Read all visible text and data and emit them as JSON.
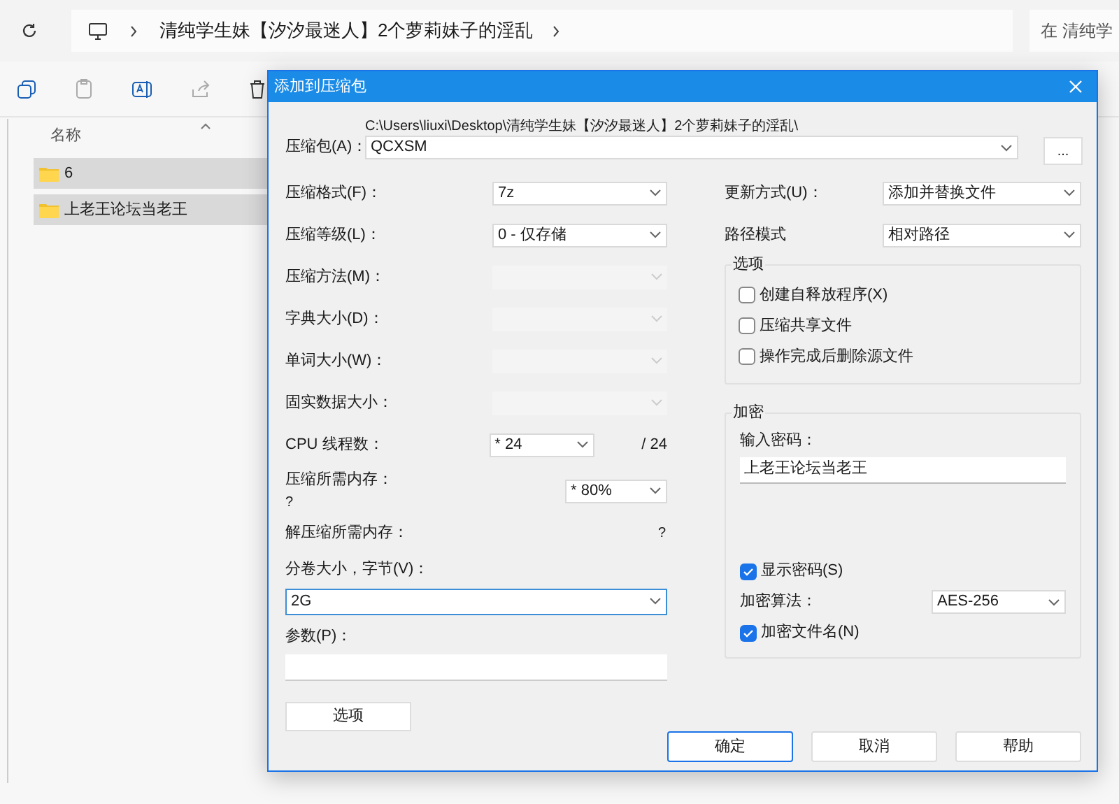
{
  "explorer": {
    "breadcrumb": "清纯学生妹【汐汐最迷人】2个萝莉妹子的淫乱",
    "search_placeholder": "在 清纯学",
    "column": "名称",
    "files": [
      {
        "name": "6",
        "selected": true
      },
      {
        "name": "上老王论坛当老王",
        "selected": true
      }
    ]
  },
  "dialog": {
    "title": "添加到压缩包",
    "archive": {
      "label": "压缩包(A)：",
      "path": "C:\\Users\\liuxi\\Desktop\\清纯学生妹【汐汐最迷人】2个萝莉妹子的淫乱\\",
      "value": "QCXSM",
      "browse": "..."
    },
    "left": [
      {
        "kind": "select",
        "label": "压缩格式(F)：",
        "value": "7z",
        "disabled": false
      },
      {
        "kind": "select",
        "label": "压缩等级(L)：",
        "value": "0 - 仅存储",
        "disabled": false
      },
      {
        "kind": "select",
        "label": "压缩方法(M)：",
        "disabled": true
      },
      {
        "kind": "select",
        "label": "字典大小(D)：",
        "disabled": true
      },
      {
        "kind": "select",
        "label": "单词大小(W)：",
        "disabled": true
      },
      {
        "kind": "select",
        "label": "固实数据大小：",
        "disabled": true
      },
      {
        "kind": "cpu",
        "label": "CPU 线程数：",
        "value": "* 24",
        "suffix": "/ 24"
      },
      {
        "kind": "memory",
        "label": "压缩所需内存：",
        "note": "?",
        "value": "* 80%"
      },
      {
        "kind": "info",
        "label": "解压缩所需内存：",
        "value": "?"
      },
      {
        "kind": "combo",
        "label": "分卷大小，字节(V)：",
        "value": "2G",
        "focused": true
      },
      {
        "kind": "input",
        "label": "参数(P)："
      }
    ],
    "options_button": "选项",
    "right": [
      {
        "label": "更新方式(U)：",
        "value": "添加并替换文件"
      },
      {
        "label": "路径模式",
        "value": "相对路径"
      }
    ],
    "options_group": {
      "title": "选项",
      "checks": [
        {
          "label": "创建自释放程序(X)",
          "checked": false
        },
        {
          "label": "压缩共享文件",
          "checked": false
        },
        {
          "label": "操作完成后删除源文件",
          "checked": false
        }
      ]
    },
    "encryption": {
      "title": "加密",
      "password_label": "输入密码：",
      "password": "上老王论坛当老王",
      "show_password": {
        "label": "显示密码(S)",
        "checked": true
      },
      "method_label": "加密算法：",
      "method": "AES-256",
      "encrypt_names": {
        "label": "加密文件名(N)",
        "checked": true
      }
    },
    "buttons": [
      {
        "label": "确定",
        "default": true
      },
      {
        "label": "取消",
        "default": false
      },
      {
        "label": "帮助",
        "default": false
      }
    ]
  }
}
